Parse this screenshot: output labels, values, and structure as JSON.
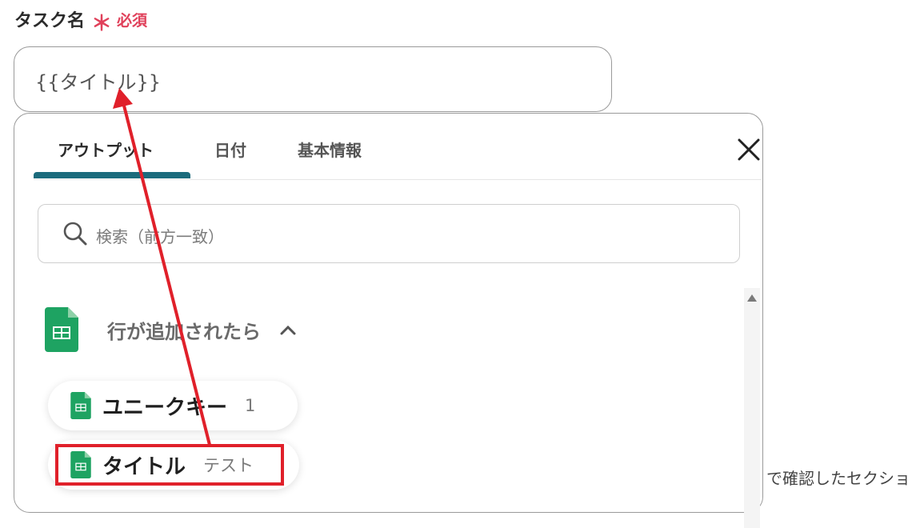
{
  "field": {
    "label": "タスク名",
    "required_mark": "＊",
    "required_text": "必須",
    "value": "{{タイトル}}"
  },
  "panel": {
    "tabs": [
      {
        "label": "アウトプット",
        "active": true
      },
      {
        "label": "日付",
        "active": false
      },
      {
        "label": "基本情報",
        "active": false
      }
    ],
    "search": {
      "placeholder": "検索（前方一致）"
    },
    "group": {
      "title": "行が追加されたら",
      "icon": "google-sheets-icon",
      "expanded": true
    },
    "items": [
      {
        "name": "ユニークキー",
        "value": "1",
        "icon": "google-sheets-icon"
      },
      {
        "name": "タイトル",
        "value": "テスト",
        "icon": "google-sheets-icon",
        "highlighted": true
      }
    ]
  },
  "background_text": "で確認したセクショ",
  "colors": {
    "accent": "#1c6b7c",
    "required": "#e0405a",
    "annotation": "#e0202a",
    "sheets_green": "#1ea362"
  }
}
